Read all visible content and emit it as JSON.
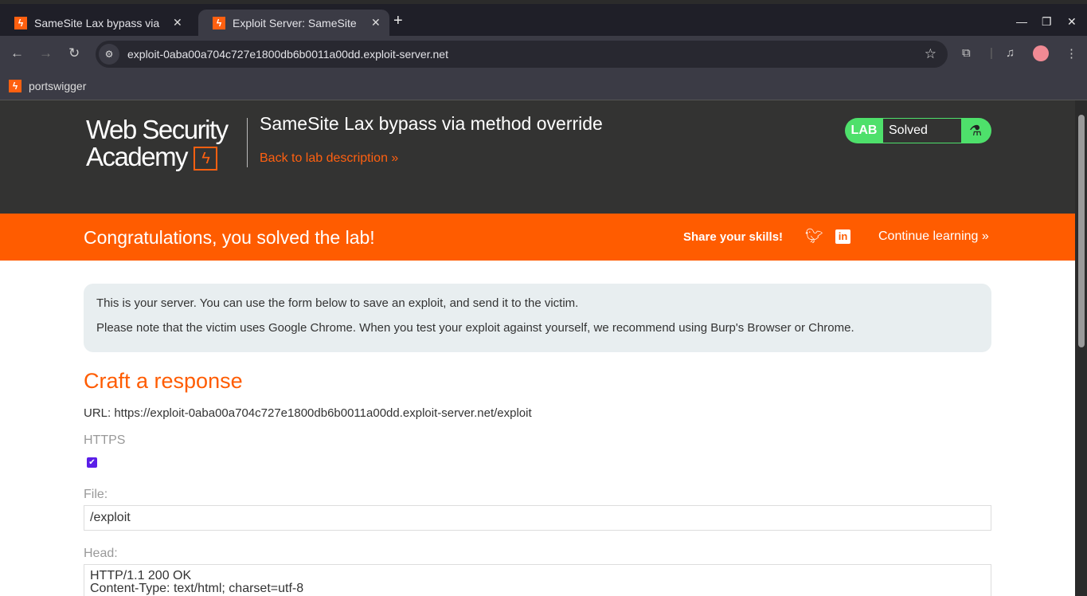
{
  "browser": {
    "tabs": [
      {
        "title": "SameSite Lax bypass via method override",
        "active": false
      },
      {
        "title": "Exploit Server: SameSite Lax bypass via method override",
        "active": true
      }
    ],
    "address": "exploit-0aba00a704c727e1800db6b0011a00dd.exploit-server.net",
    "bookmark": "portswigger"
  },
  "header": {
    "logo_line1": "Web Security",
    "logo_line2": "Academy",
    "lab_title": "SameSite Lax bypass via method override",
    "back_link": "Back to lab description »",
    "badge_lab": "LAB",
    "badge_status": "Solved",
    "badge_color": "#4ee06b"
  },
  "banner": {
    "message": "Congratulations, you solved the lab!",
    "share": "Share your skills!",
    "continue": "Continue learning »",
    "color": "#ff5c00"
  },
  "info": {
    "line1": "This is your server. You can use the form below to save an exploit, and send it to the victim.",
    "line2": "Please note that the victim uses Google Chrome. When you test your exploit against yourself, we recommend using Burp's Browser or Chrome."
  },
  "form": {
    "heading": "Craft a response",
    "url_line": "URL: https://exploit-0aba00a704c727e1800db6b0011a00dd.exploit-server.net/exploit",
    "https_label": "HTTPS",
    "https_checked": true,
    "file_label": "File:",
    "file_value": "/exploit",
    "head_label": "Head:",
    "head_line1": "HTTP/1.1 200 OK",
    "head_line2": "Content-Type: text/html; charset=utf-8"
  }
}
